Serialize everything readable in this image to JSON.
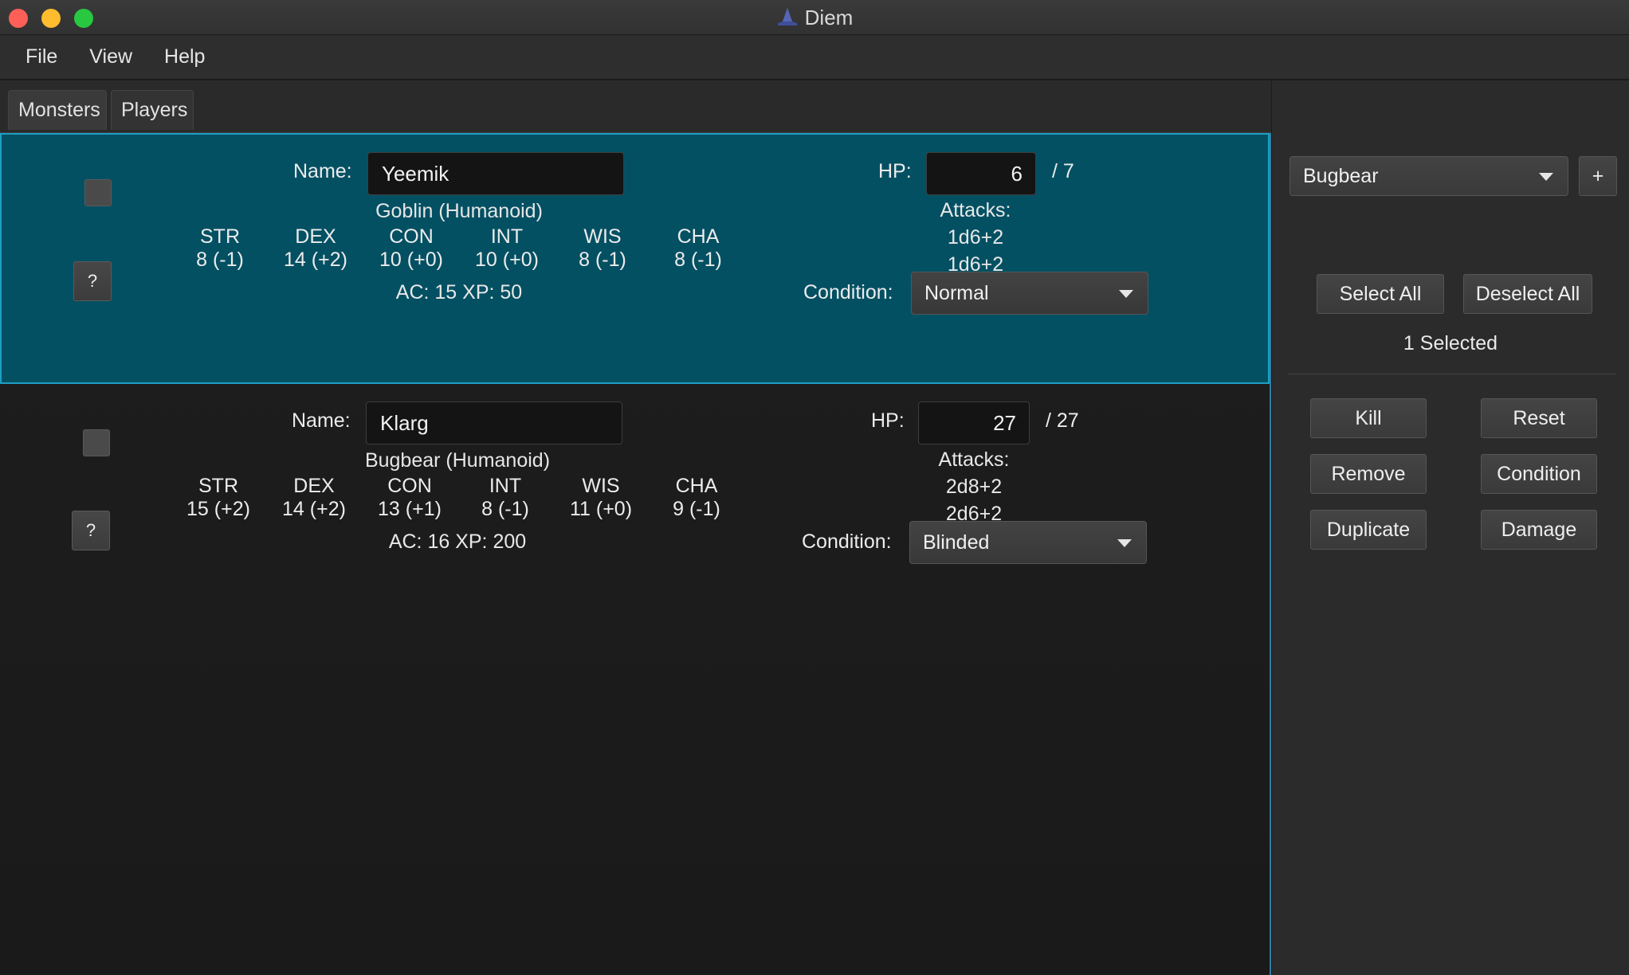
{
  "window": {
    "title": "Diem"
  },
  "menu": [
    "File",
    "View",
    "Help"
  ],
  "tabs": [
    {
      "label": "Monsters",
      "active": true
    },
    {
      "label": "Players",
      "active": false
    }
  ],
  "monsters": [
    {
      "selected": true,
      "name_label": "Name:",
      "name": "Yeemik",
      "hp_label": "HP:",
      "hp_current": "6",
      "hp_max": "/ 7",
      "type": "Goblin (Humanoid)",
      "stats": [
        {
          "label": "STR",
          "value": "8 (-1)"
        },
        {
          "label": "DEX",
          "value": "14 (+2)"
        },
        {
          "label": "CON",
          "value": "10 (+0)"
        },
        {
          "label": "INT",
          "value": "10 (+0)"
        },
        {
          "label": "WIS",
          "value": "8 (-1)"
        },
        {
          "label": "CHA",
          "value": "8 (-1)"
        }
      ],
      "attacks_label": "Attacks:",
      "attacks": [
        "1d6+2",
        "1d6+2"
      ],
      "ac_xp": "AC: 15 XP: 50",
      "condition_label": "Condition:",
      "condition": "Normal",
      "help_label": "?"
    },
    {
      "selected": false,
      "name_label": "Name:",
      "name": "Klarg",
      "hp_label": "HP:",
      "hp_current": "27",
      "hp_max": "/ 27",
      "type": "Bugbear (Humanoid)",
      "stats": [
        {
          "label": "STR",
          "value": "15 (+2)"
        },
        {
          "label": "DEX",
          "value": "14 (+2)"
        },
        {
          "label": "CON",
          "value": "13 (+1)"
        },
        {
          "label": "INT",
          "value": "8 (-1)"
        },
        {
          "label": "WIS",
          "value": "11 (+0)"
        },
        {
          "label": "CHA",
          "value": "9 (-1)"
        }
      ],
      "attacks_label": "Attacks:",
      "attacks": [
        "2d8+2",
        "2d6+2"
      ],
      "ac_xp": "AC: 16 XP: 200",
      "condition_label": "Condition:",
      "condition": "Blinded",
      "help_label": "?"
    }
  ],
  "side": {
    "monster_select": "Bugbear",
    "add_label": "+",
    "select_all": "Select All",
    "deselect_all": "Deselect All",
    "selected_count": "1 Selected",
    "actions": {
      "kill": "Kill",
      "reset": "Reset",
      "remove": "Remove",
      "condition": "Condition",
      "duplicate": "Duplicate",
      "damage": "Damage"
    }
  },
  "colors": {
    "selected_row_bg": "#045063",
    "selected_row_border": "#1d9fc4"
  }
}
